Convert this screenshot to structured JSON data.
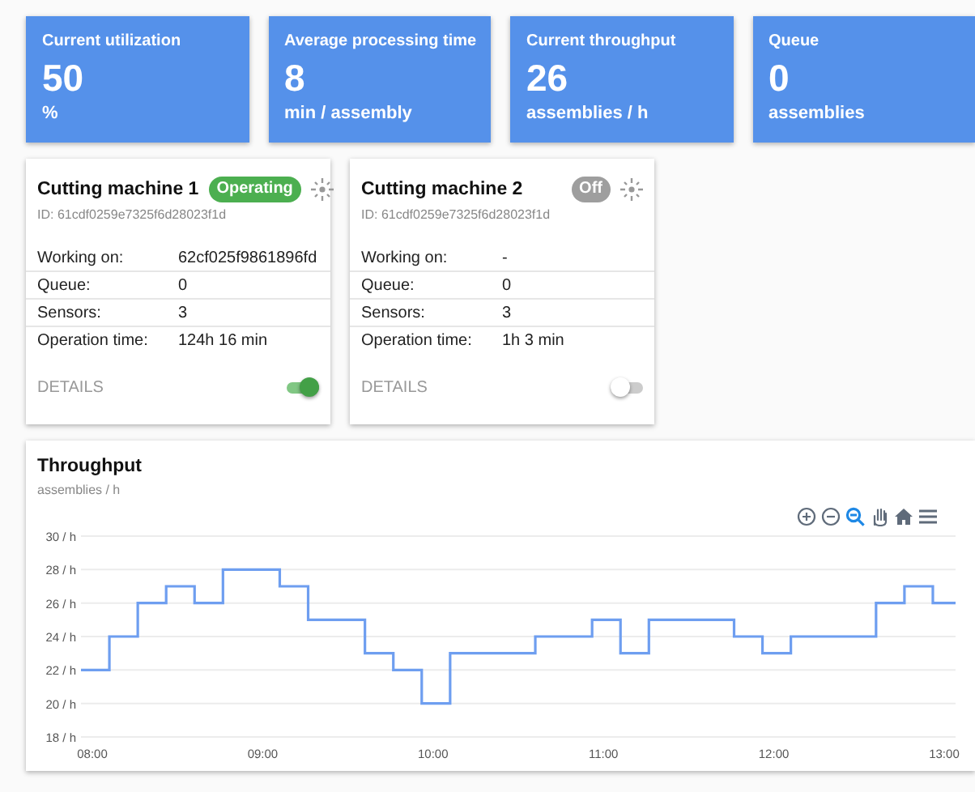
{
  "kpis": [
    {
      "title": "Current utilization",
      "value": "50",
      "unit": "%"
    },
    {
      "title": "Average processing time",
      "value": "8",
      "unit": "min / assembly"
    },
    {
      "title": "Current throughput",
      "value": "26",
      "unit": "assemblies / h"
    },
    {
      "title": "Queue",
      "value": "0",
      "unit": "assemblies"
    }
  ],
  "machines": [
    {
      "name": "Cutting machine 1",
      "status": {
        "label": "Operating",
        "active": true
      },
      "id": "ID: 61cdf0259e7325f6d28023f1d",
      "rows": [
        {
          "label": "Working on:",
          "value": "62cf025f9861896fd"
        },
        {
          "label": "Queue:",
          "value": "0"
        },
        {
          "label": "Sensors:",
          "value": "3"
        },
        {
          "label": "Operation time:",
          "value": "124h 16 min"
        }
      ],
      "details": "DETAILS",
      "on": true
    },
    {
      "name": "Cutting machine 2",
      "status": {
        "label": "Off",
        "active": false
      },
      "id": "ID: 61cdf0259e7325f6d28023f1d",
      "rows": [
        {
          "label": "Working on:",
          "value": "-"
        },
        {
          "label": "Queue:",
          "value": "0"
        },
        {
          "label": "Sensors:",
          "value": "3"
        },
        {
          "label": "Operation time:",
          "value": "1h 3 min"
        }
      ],
      "details": "DETAILS",
      "on": false
    }
  ],
  "throughput": {
    "title": "Throughput",
    "subtitle": "assemblies / h",
    "tools": [
      {
        "kind": "zoom-in",
        "selected": false
      },
      {
        "kind": "zoom-out",
        "selected": false
      },
      {
        "kind": "zoom",
        "selected": true
      },
      {
        "kind": "pan",
        "selected": false
      },
      {
        "kind": "home",
        "selected": false
      },
      {
        "kind": "menu",
        "selected": false
      }
    ],
    "chart_data": {
      "type": "line",
      "grid": true,
      "x": [
        476,
        486,
        486,
        496,
        496,
        506,
        506,
        516,
        516,
        526,
        526,
        546,
        546,
        556,
        556,
        576,
        576,
        586,
        586,
        596,
        596,
        606,
        606,
        636,
        636,
        656,
        656,
        666,
        666,
        676,
        676,
        706,
        706,
        716,
        716,
        726,
        726,
        756,
        756,
        766,
        766,
        776,
        776,
        784
      ],
      "series": [
        {
          "color": "#6e9ef0",
          "values": [
            22,
            22,
            24,
            24,
            26,
            26,
            27,
            27,
            26,
            26,
            28,
            28,
            27,
            27,
            25,
            25,
            23,
            23,
            22,
            22,
            20,
            20,
            23,
            23,
            24,
            24,
            25,
            25,
            23,
            23,
            25,
            25,
            24,
            24,
            23,
            23,
            24,
            24,
            26,
            26,
            27,
            27,
            26,
            26
          ]
        }
      ],
      "xlim": [
        476,
        784
      ],
      "ylim": [
        18,
        30
      ],
      "yticks": [
        {
          "value": 18,
          "label": "18 / h"
        },
        {
          "value": 20,
          "label": "20 / h"
        },
        {
          "value": 22,
          "label": "22 / h"
        },
        {
          "value": 24,
          "label": "24 / h"
        },
        {
          "value": 26,
          "label": "26 / h"
        },
        {
          "value": 28,
          "label": "28 / h"
        },
        {
          "value": 30,
          "label": "30 / h"
        }
      ],
      "xticks": [
        {
          "value": 480,
          "label": "08:00"
        },
        {
          "value": 540,
          "label": "09:00"
        },
        {
          "value": 600,
          "label": "10:00"
        },
        {
          "value": 660,
          "label": "11:00"
        },
        {
          "value": 720,
          "label": "12:00"
        },
        {
          "value": 780,
          "label": "13:00"
        }
      ]
    }
  }
}
